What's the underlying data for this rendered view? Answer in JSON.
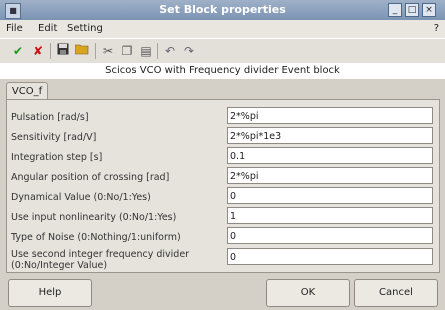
{
  "window": {
    "title": "Set Block properties"
  },
  "menu": {
    "file": "File",
    "edit": "Edit",
    "setting": "Setting",
    "help": "?"
  },
  "description": "Scicos VCO with Frequency divider Event block",
  "tab": "VCO_f",
  "rows": [
    {
      "label": "Pulsation [rad/s]",
      "value": "2*%pi"
    },
    {
      "label": "Sensitivity [rad/V]",
      "value": "2*%pi*1e3"
    },
    {
      "label": "Integration step [s]",
      "value": "0.1"
    },
    {
      "label": "Angular position of crossing [rad]",
      "value": "2*%pi"
    },
    {
      "label": "Dynamical Value (0:No/1:Yes)",
      "value": "0"
    },
    {
      "label": "Use input nonlinearity (0:No/1:Yes)",
      "value": "1"
    },
    {
      "label": "Type of Noise (0:Nothing/1:uniform)",
      "value": "0"
    },
    {
      "label": "Use second integer frequency divider",
      "label2": "(0:No/Integer Value)",
      "value": "0"
    }
  ],
  "buttons": {
    "help": "Help",
    "ok": "OK",
    "cancel": "Cancel"
  },
  "colors": {
    "titlebar": "#7b93b3",
    "panel": "#e6e3dd"
  }
}
